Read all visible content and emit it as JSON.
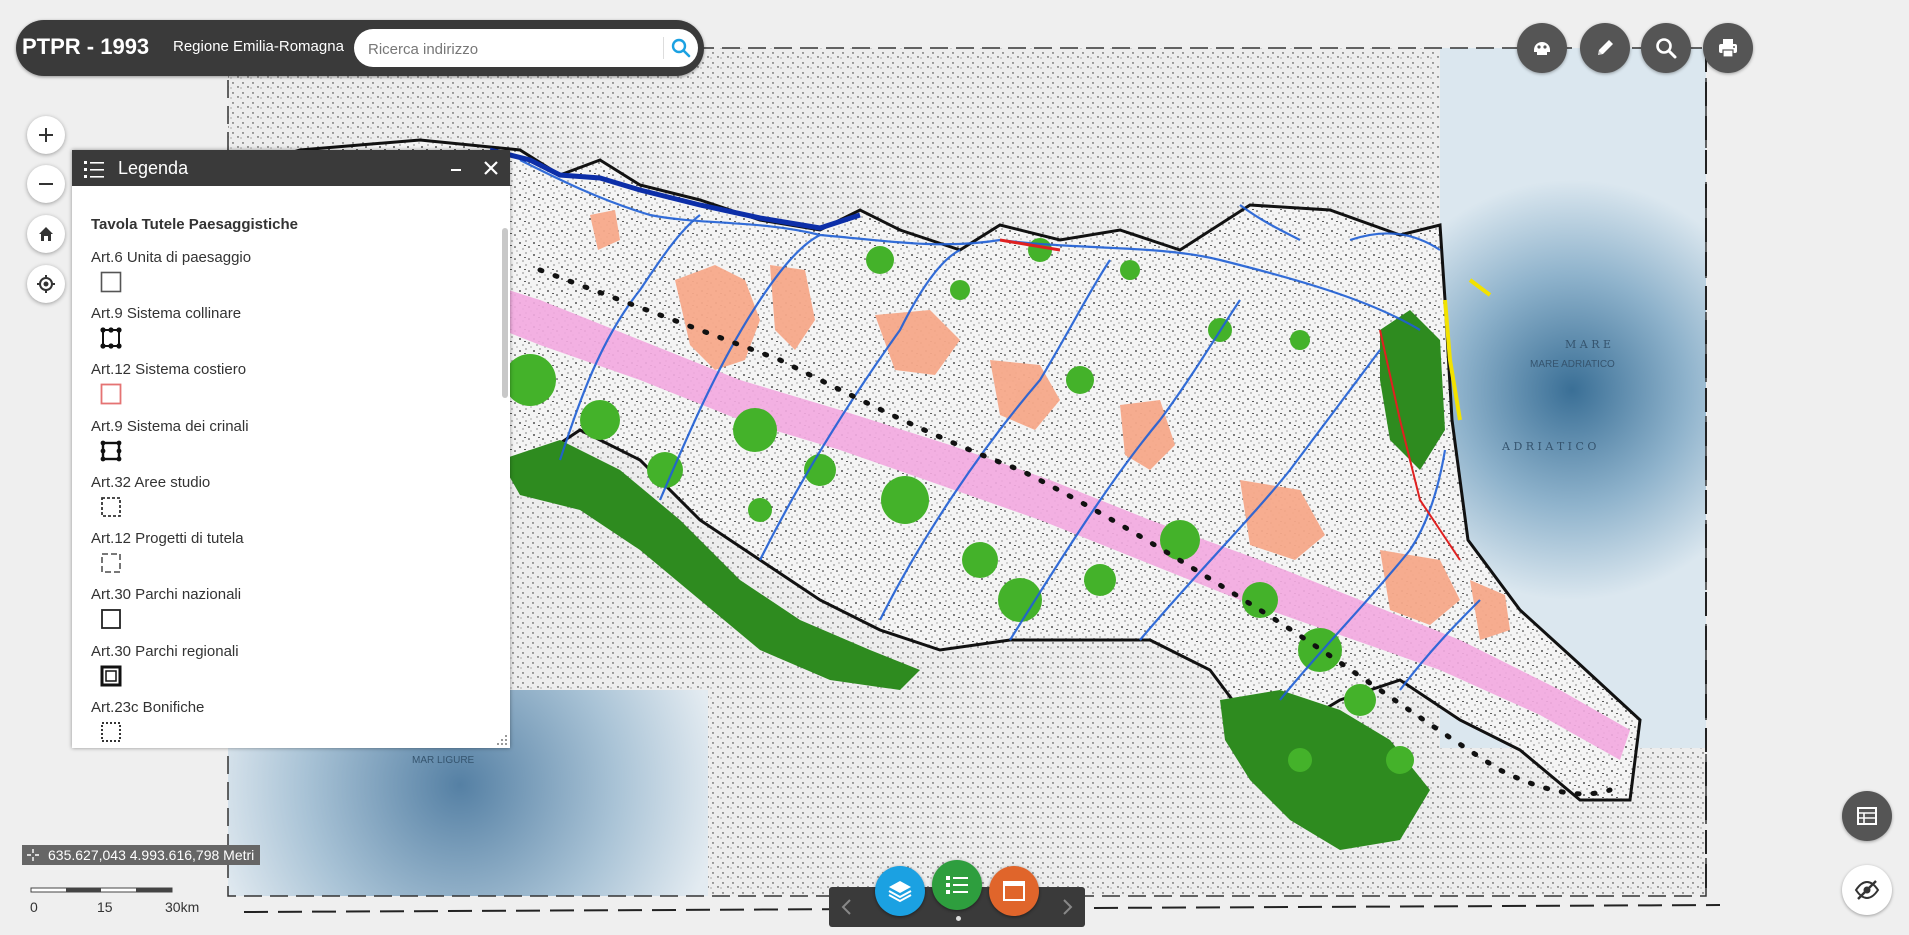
{
  "header": {
    "title": "PTPR - 1993",
    "subtitle": "Regione Emilia-Romagna",
    "search_placeholder": "Ricerca indirizzo"
  },
  "toolbar_icons": [
    "plugin-icon",
    "pencil-icon",
    "magnifier-icon",
    "printer-icon"
  ],
  "nav_icons": [
    "zoom-in-icon",
    "zoom-out-icon",
    "home-icon",
    "locate-icon"
  ],
  "legend": {
    "title": "Legenda",
    "section_title": "Tavola Tutele Paesaggistiche",
    "items": [
      {
        "label": "Art.6 Unita di paesaggio"
      },
      {
        "label": "Art.9 Sistema collinare"
      },
      {
        "label": "Art.12 Sistema costiero"
      },
      {
        "label": "Art.9 Sistema dei crinali"
      },
      {
        "label": "Art.32 Aree studio"
      },
      {
        "label": "Art.12 Progetti di tutela"
      },
      {
        "label": "Art.30 Parchi nazionali"
      },
      {
        "label": "Art.30 Parchi regionali"
      },
      {
        "label": "Art.23c Bonifiche"
      }
    ]
  },
  "map": {
    "labels": {
      "mare_adriatico": "MARE ADRIATICO",
      "mare": "M A R E",
      "adriatico": "A D R I A T I C O",
      "mar_ligure": "MAR LIGURE"
    }
  },
  "coordinates": "635.627,043 4.993.616,798 Metri",
  "scale": {
    "labels": [
      "0",
      "15",
      "30km"
    ]
  },
  "bottom_bar": {
    "buttons": [
      {
        "icon": "layers-icon",
        "color": "#1ba1e2"
      },
      {
        "icon": "legend-list-icon",
        "color": "#2e9e3e"
      },
      {
        "icon": "window-icon",
        "color": "#e0652b"
      }
    ]
  },
  "colors": {
    "header_bg": "#3a3a3a",
    "accent_blue": "#1ba1e2",
    "accent_green": "#2e9e3e",
    "accent_orange": "#e0652b",
    "legend_coastal": "#e57373"
  }
}
